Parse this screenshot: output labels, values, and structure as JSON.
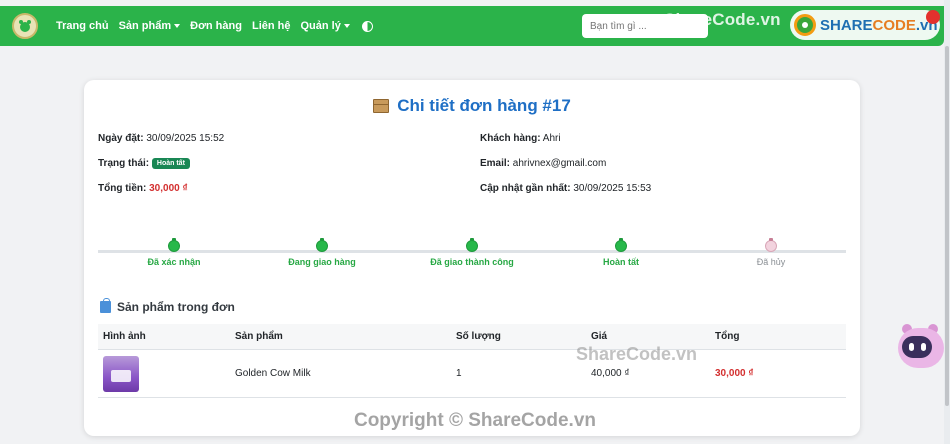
{
  "navbar": {
    "links": [
      {
        "label": "Trang chủ",
        "dropdown": false
      },
      {
        "label": "Sản phẩm",
        "dropdown": true
      },
      {
        "label": "Đơn hàng",
        "dropdown": false
      },
      {
        "label": "Liên hệ",
        "dropdown": false
      },
      {
        "label": "Quản lý",
        "dropdown": true
      }
    ],
    "search_placeholder": "Bạn tìm gì ...",
    "accent_color": "#2bb34a"
  },
  "watermarks": {
    "top": "ShareCode.vn",
    "logo_prefix": "SHARE",
    "logo_suffix": "CODE",
    "logo_tld": ".vn",
    "middle": "ShareCode.vn",
    "copyright": "Copyright © ShareCode.vn"
  },
  "order": {
    "title": "Chi tiết đơn hàng #17",
    "order_date_label": "Ngày đặt:",
    "order_date": "30/09/2025 15:52",
    "status_label": "Trạng thái:",
    "status": "Hoàn tất",
    "total_label": "Tổng tiền:",
    "total": "30,000 ₫",
    "customer_label": "Khách hàng:",
    "customer": "Ahri",
    "email_label": "Email:",
    "email": "ahrivnex@gmail.com",
    "updated_label": "Cập nhật gần nhất:",
    "updated": "30/09/2025 15:53"
  },
  "progress": {
    "steps": [
      {
        "label": "Đã xác nhận",
        "done": true
      },
      {
        "label": "Đang giao hàng",
        "done": true
      },
      {
        "label": "Đã giao thành công",
        "done": true
      },
      {
        "label": "Hoàn tất",
        "done": true
      },
      {
        "label": "Đã hủy",
        "done": false
      }
    ]
  },
  "products": {
    "section_title": "Sản phẩm trong đơn",
    "headers": [
      "Hình ảnh",
      "Sản phẩm",
      "Số lượng",
      "Giá",
      "Tổng"
    ],
    "rows": [
      {
        "image": "milk-product-thumbnail",
        "name": "Golden Cow Milk",
        "quantity": "1",
        "price": "40,000 ₫",
        "total": "30,000 ₫"
      }
    ]
  }
}
